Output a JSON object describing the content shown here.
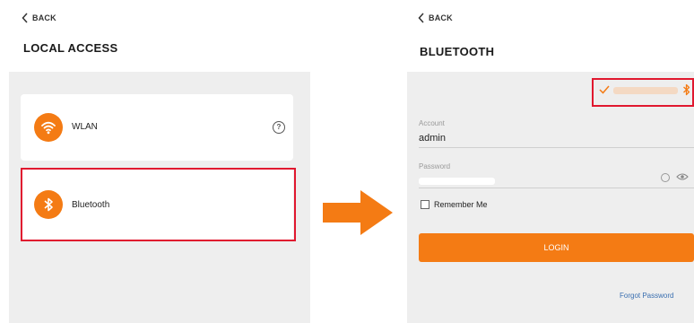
{
  "colors": {
    "accent": "#f47b14",
    "highlight": "#e0182f",
    "link": "#3a6fb0"
  },
  "left_screen": {
    "back_label": "BACK",
    "title": "LOCAL ACCESS",
    "items": [
      {
        "label": "WLAN",
        "icon": "wifi-icon",
        "help_icon": "help-icon"
      },
      {
        "label": "Bluetooth",
        "icon": "bluetooth-icon"
      }
    ]
  },
  "right_screen": {
    "back_label": "BACK",
    "title": "BLUETOOTH",
    "device_status_icons": [
      "check-icon",
      "bluetooth-icon"
    ],
    "account_label": "Account",
    "account_value": "admin",
    "password_label": "Password",
    "remember_label": "Remember Me",
    "login_label": "LOGIN",
    "forgot_label": "Forgot Password"
  }
}
